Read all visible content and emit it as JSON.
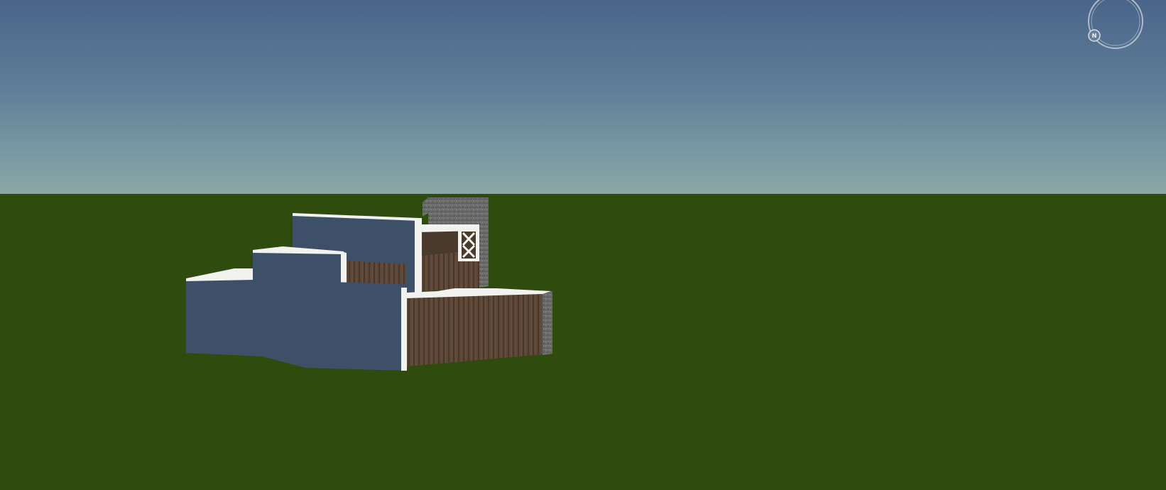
{
  "colors": {
    "sky_top": "#4a6589",
    "sky_horizon": "#8ba6a6",
    "ground": "#2f4b0e",
    "wall_blue": "#3d5068",
    "wall_trim": "#f2f2ee",
    "wood": "#5b4636",
    "stone": "#6b6b6b"
  },
  "compass": {
    "label": "N",
    "icon": "compass-icon"
  }
}
